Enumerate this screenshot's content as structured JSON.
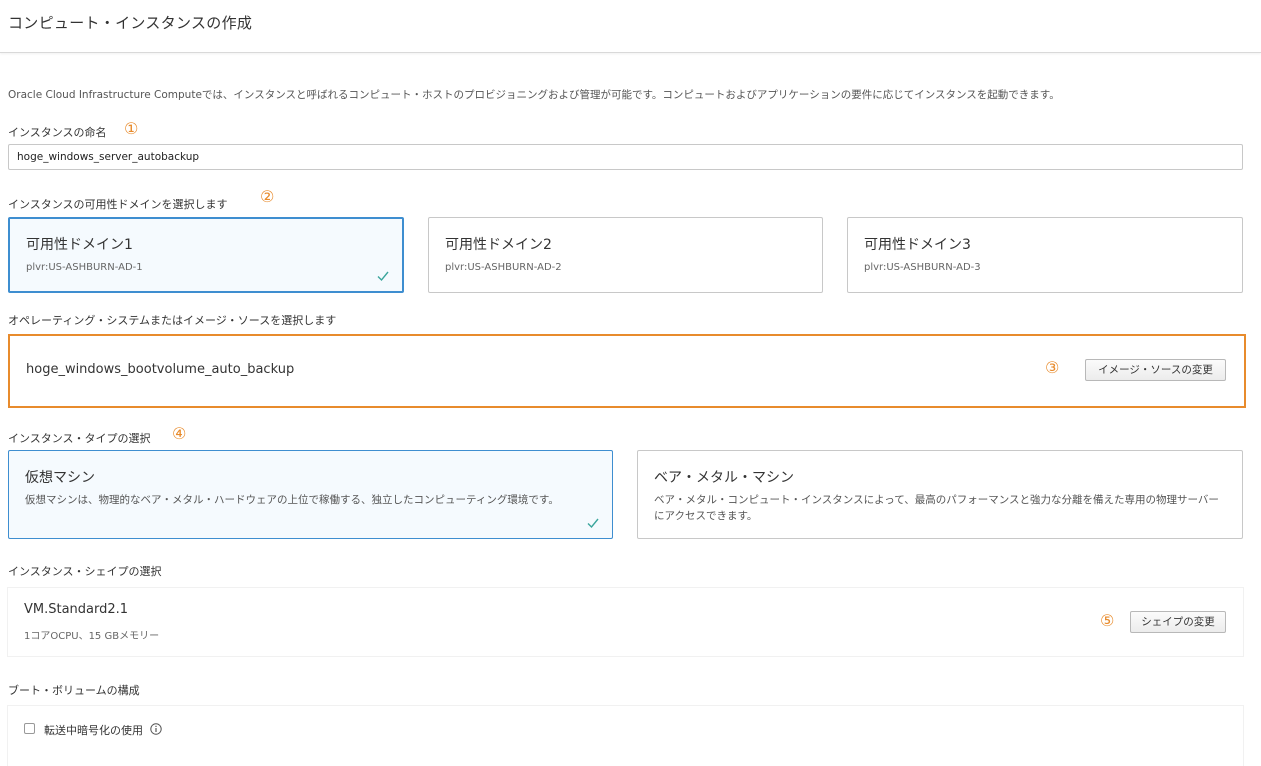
{
  "page": {
    "title": "コンピュート・インスタンスの作成",
    "intro": "Oracle Cloud Infrastructure Computeでは、インスタンスと呼ばれるコンピュート・ホストのプロビジョニングおよび管理が可能です。コンピュートおよびアプリケーションの要件に応じてインスタンスを起動できます。"
  },
  "markers": [
    "①",
    "②",
    "③",
    "④",
    "⑤"
  ],
  "name_section": {
    "label": "インスタンスの命名",
    "value": "hoge_windows_server_autobackup"
  },
  "ad_section": {
    "label": "インスタンスの可用性ドメインを選択します",
    "options": [
      {
        "title": "可用性ドメイン1",
        "subtitle": "plvr:US-ASHBURN-AD-1",
        "selected": true
      },
      {
        "title": "可用性ドメイン2",
        "subtitle": "plvr:US-ASHBURN-AD-2",
        "selected": false
      },
      {
        "title": "可用性ドメイン3",
        "subtitle": "plvr:US-ASHBURN-AD-3",
        "selected": false
      }
    ]
  },
  "image_section": {
    "label": "オペレーティング・システムまたはイメージ・ソースを選択します",
    "image_name": "hoge_windows_bootvolume_auto_backup",
    "change_button": "イメージ・ソースの変更"
  },
  "type_section": {
    "label": "インスタンス・タイプの選択",
    "options": [
      {
        "title": "仮想マシン",
        "description": "仮想マシンは、物理的なベア・メタル・ハードウェアの上位で稼働する、独立したコンピューティング環境です。",
        "selected": true
      },
      {
        "title": "ベア・メタル・マシン",
        "description": "ベア・メタル・コンピュート・インスタンスによって、最高のパフォーマンスと強力な分離を備えた専用の物理サーバーにアクセスできます。",
        "selected": false
      }
    ]
  },
  "shape_section": {
    "label": "インスタンス・シェイプの選択",
    "shape_name": "VM.Standard2.1",
    "shape_detail": "1コアOCPU、15 GBメモリー",
    "change_button": "シェイプの変更"
  },
  "boot_section": {
    "label": "ブート・ボリュームの構成",
    "encryption_checkbox_label": "転送中暗号化の使用",
    "encryption_checked": false
  },
  "colors": {
    "accent_orange": "#e88b2c",
    "selected_border": "#3e8ed0",
    "check_teal": "#3aa59c"
  }
}
